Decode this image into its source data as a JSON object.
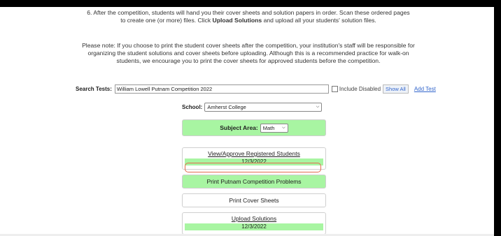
{
  "instructions": {
    "step6_prefix": "6. After the competition, students will hand you their cover sheets and solution papers in order. Scan these ordered pages to create one (or more) files. Click ",
    "step6_bold": "Upload Solutions",
    "step6_suffix": " and upload all your students' solution files.",
    "note": "Please note: If you choose to print the student cover sheets after the competition, your institution's staff will be responsible for organizing the student solutions and cover sheets before uploading. Although this is a recommended practice for walk-on students, we encourage you to print the cover sheets for approved students before the competition."
  },
  "search": {
    "label": "Search Tests:",
    "value": "William Lowell Putnam Competition 2022",
    "include_disabled_label": "Include Disabled",
    "include_disabled_checked": false,
    "show_all_label": "Show All",
    "add_test_label": "Add Test"
  },
  "school": {
    "label": "School:",
    "value": "Amherst College"
  },
  "subject": {
    "label": "Subject Area:",
    "value": "Math"
  },
  "actions": {
    "view_approve_label": "View/Approve Registered Students",
    "view_approve_date": "12/3/2022",
    "print_problems_label": "Print Putnam Competition Problems",
    "print_cover_label": "Print Cover Sheets",
    "upload_label": "Upload Solutions",
    "upload_date": "12/3/2022"
  },
  "colors": {
    "green": "#a8f5a2",
    "highlight": "#e56a4e",
    "link": "#3366cc"
  }
}
